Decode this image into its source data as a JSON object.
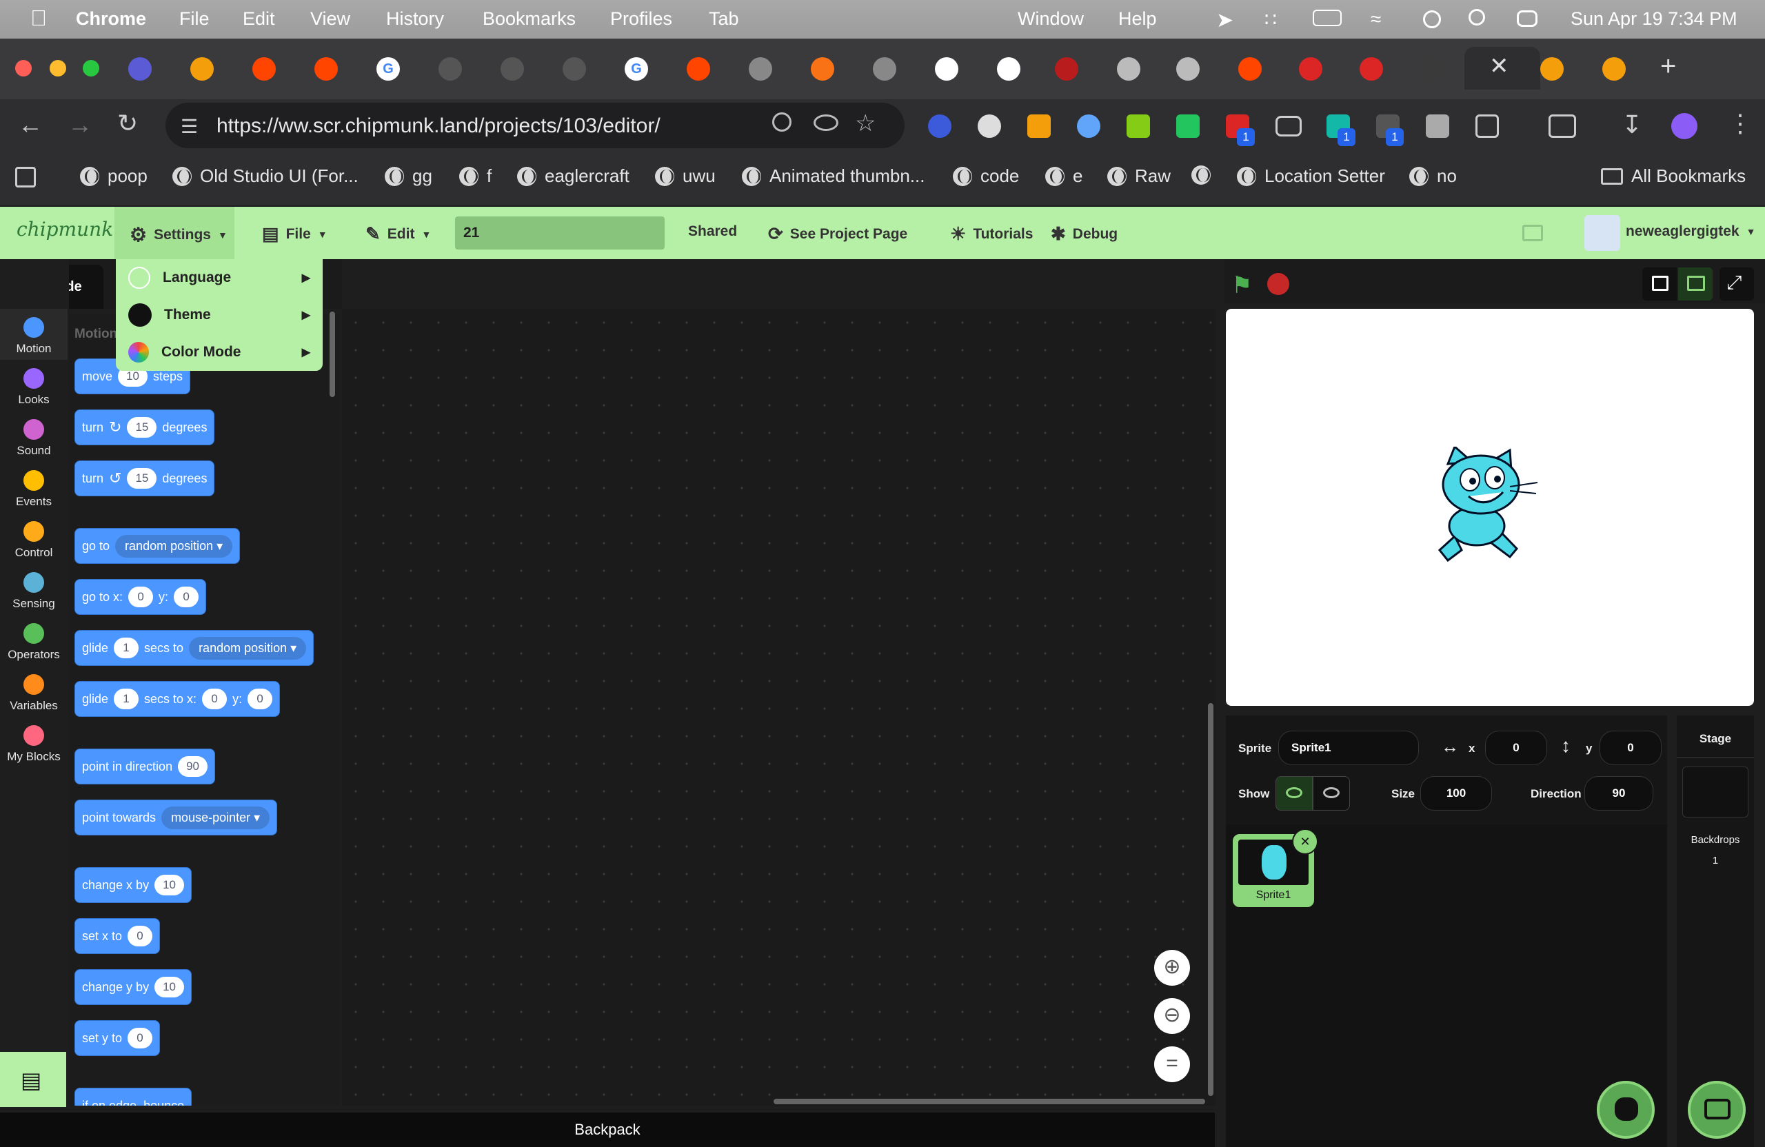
{
  "macos": {
    "app": "Chrome",
    "menus": [
      "File",
      "Edit",
      "View",
      "History",
      "Bookmarks",
      "Profiles",
      "Tab",
      "Window",
      "Help"
    ],
    "datetime": "Sun Apr 19  7:34 PM"
  },
  "browser": {
    "url": "https://ww.scr.chipmunk.land/projects/103/editor/",
    "bookmarks": [
      "poop",
      "Old Studio UI (For...",
      "gg",
      "f",
      "eaglercraft",
      "uwu",
      "Animated thumbn...",
      "code",
      "e",
      "Raw",
      "Location Setter",
      "no"
    ],
    "all_bookmarks": "All Bookmarks",
    "ext_badges": [
      "1",
      "1",
      "1"
    ]
  },
  "editor": {
    "menu": {
      "settings": "Settings",
      "file": "File",
      "edit": "Edit",
      "project_title": "21",
      "shared": "Shared",
      "see_project": "See Project Page",
      "tutorials": "Tutorials",
      "debug": "Debug",
      "username": "neweaglergigtek"
    },
    "settings_menu": [
      "Language",
      "Theme",
      "Color Mode"
    ],
    "code_tab": "Code",
    "categories": [
      {
        "label": "Motion",
        "color": "#4c97ff"
      },
      {
        "label": "Looks",
        "color": "#9966ff"
      },
      {
        "label": "Sound",
        "color": "#cf63cf"
      },
      {
        "label": "Events",
        "color": "#ffbf00"
      },
      {
        "label": "Control",
        "color": "#ffab19"
      },
      {
        "label": "Sensing",
        "color": "#5cb1d6"
      },
      {
        "label": "Operators",
        "color": "#59c059"
      },
      {
        "label": "Variables",
        "color": "#ff8c1a"
      },
      {
        "label": "My Blocks",
        "color": "#ff6680"
      }
    ],
    "palette_heading": "Motion",
    "blocks": {
      "move": [
        "move",
        "10",
        "steps"
      ],
      "turn_cw": [
        "turn",
        "15",
        "degrees"
      ],
      "turn_ccw": [
        "turn",
        "15",
        "degrees"
      ],
      "goto": [
        "go to",
        "random position"
      ],
      "goto_xy": [
        "go to x:",
        "0",
        "y:",
        "0"
      ],
      "glide_to": [
        "glide",
        "1",
        "secs to",
        "random position"
      ],
      "glide_xy": [
        "glide",
        "1",
        "secs to x:",
        "0",
        "y:",
        "0"
      ],
      "point_dir": [
        "point in direction",
        "90"
      ],
      "point_towards": [
        "point towards",
        "mouse-pointer"
      ],
      "change_x": [
        "change x by",
        "10"
      ],
      "set_x": [
        "set x to",
        "0"
      ],
      "change_y": [
        "change y by",
        "10"
      ],
      "set_y": [
        "set y to",
        "0"
      ],
      "edge": [
        "if on edge, bounce"
      ]
    },
    "backpack": "Backpack",
    "sprite_info": {
      "sprite_label": "Sprite",
      "sprite_name": "Sprite1",
      "x_label": "x",
      "x": "0",
      "y_label": "y",
      "y": "0",
      "show_label": "Show",
      "size_label": "Size",
      "size": "100",
      "direction_label": "Direction",
      "direction": "90"
    },
    "sprites": [
      "Sprite1"
    ],
    "stage_pane": {
      "title": "Stage",
      "backdrops_label": "Backdrops",
      "backdrops_count": "1"
    }
  }
}
